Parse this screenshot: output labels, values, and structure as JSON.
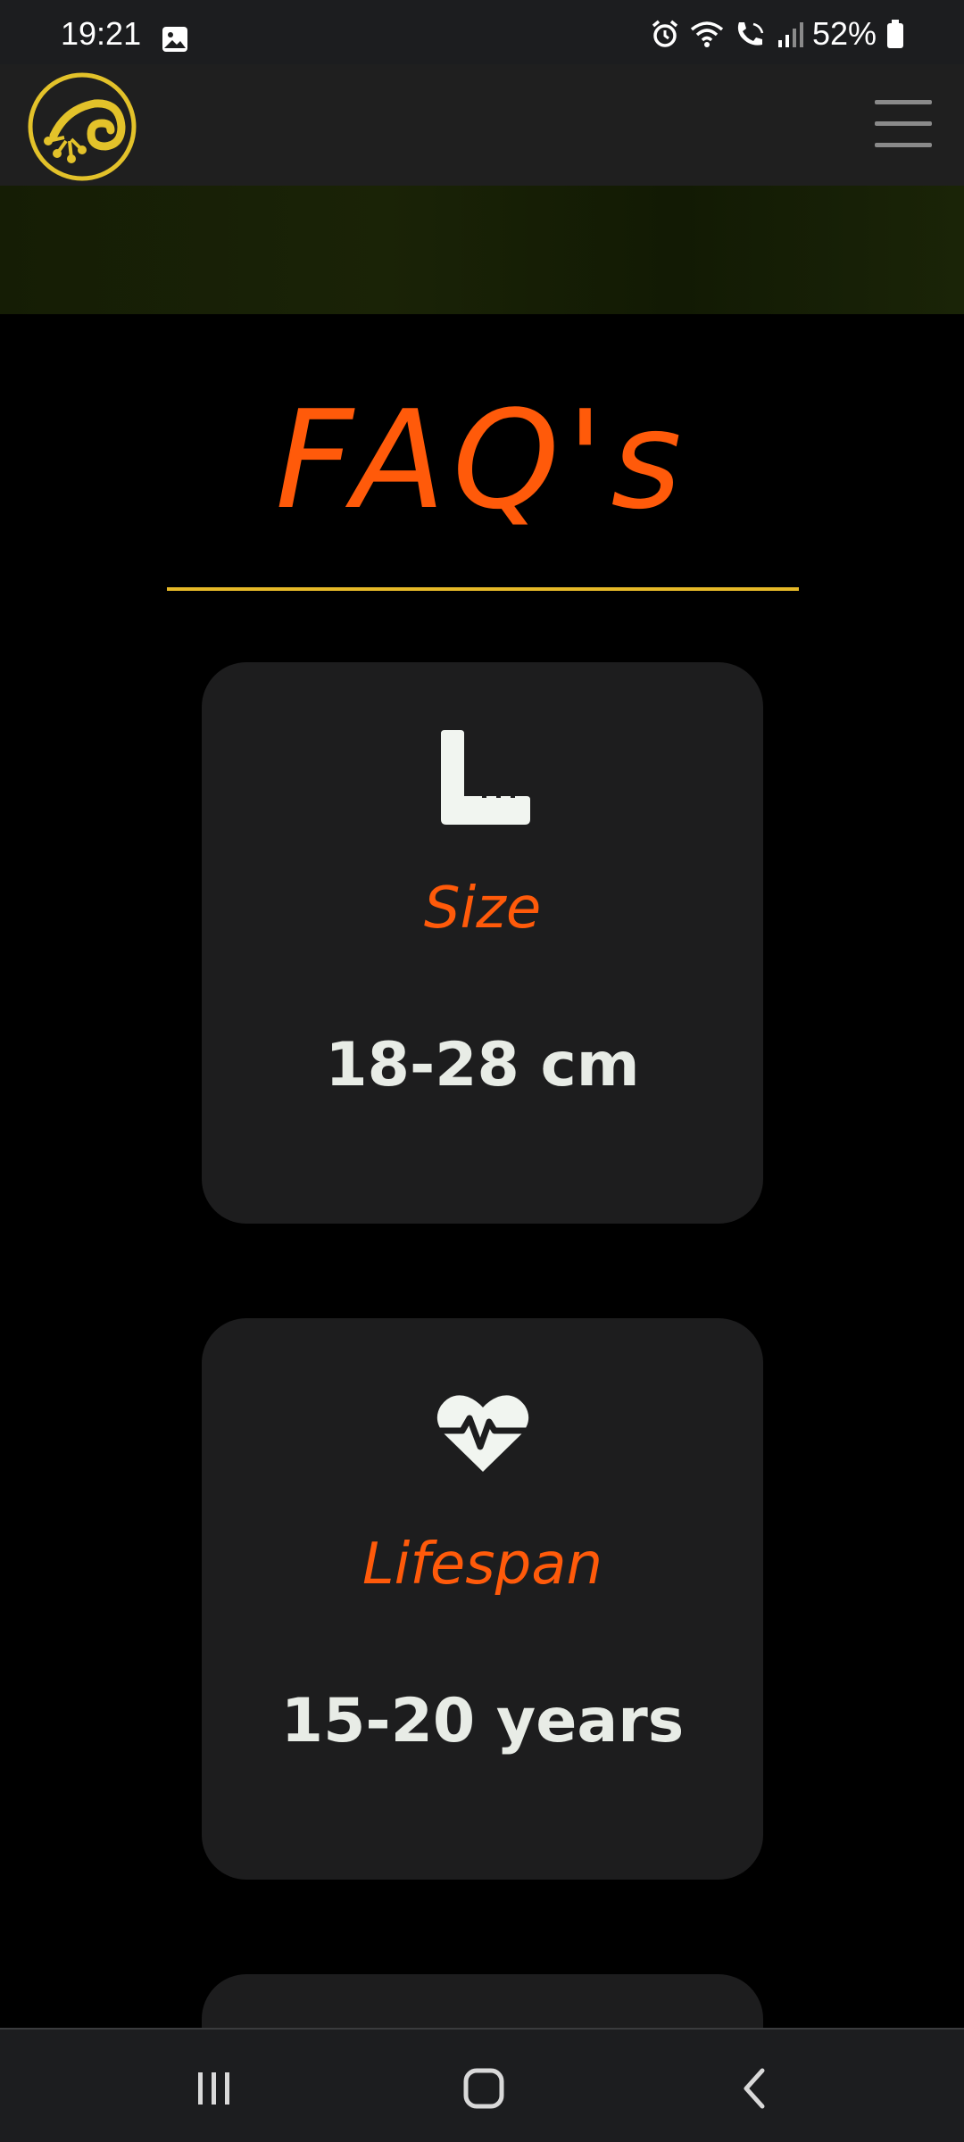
{
  "status_bar": {
    "time": "19:21",
    "battery": "52%",
    "icons": [
      "gallery-icon",
      "alarm-icon",
      "wifi-icon",
      "wifi-call-icon",
      "signal-icon",
      "battery-icon"
    ]
  },
  "header": {
    "logo": "gecko-logo",
    "menu_icon": "hamburger-menu-icon"
  },
  "main": {
    "title": "FAQ's",
    "cards": [
      {
        "icon": "ruler-icon",
        "label": "Size",
        "value": "18-28 cm"
      },
      {
        "icon": "heart-pulse-icon",
        "label": "Lifespan",
        "value": "15-20 years"
      }
    ]
  },
  "nav_bar": {
    "buttons": [
      "recents-icon",
      "home-icon",
      "back-icon"
    ]
  },
  "colors": {
    "accent_orange": "#ff5a0a",
    "underline_gold": "#e6b928",
    "logo_gold": "#e3c22a",
    "card_bg": "#1d1d1e",
    "value_text": "#e8ece6"
  }
}
